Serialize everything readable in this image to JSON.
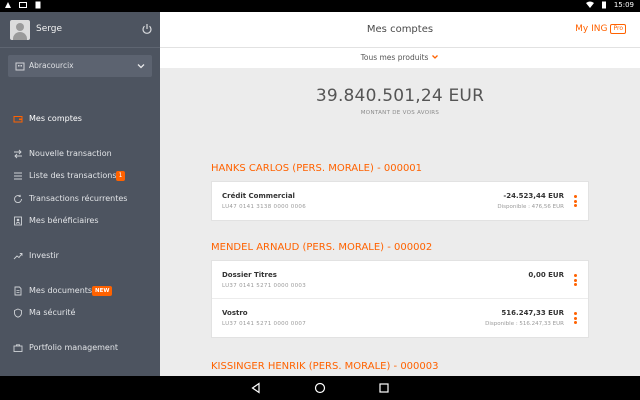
{
  "status_bar": {
    "time": "15:09"
  },
  "sidebar": {
    "user_name": "Serge",
    "company": "Abracourcix",
    "items": [
      {
        "label": "Mes comptes",
        "icon": "wallet-icon"
      },
      {
        "label": "Nouvelle transaction",
        "icon": "transfer-arrows-icon"
      },
      {
        "label": "Liste des transactions",
        "icon": "list-icon",
        "badge": "1"
      },
      {
        "label": "Transactions récurrentes",
        "icon": "recurring-icon"
      },
      {
        "label": "Mes bénéficiaires",
        "icon": "contacts-icon"
      },
      {
        "label": "Investir",
        "icon": "trend-up-icon"
      },
      {
        "label": "Mes documents",
        "icon": "document-icon",
        "badge": "NEW"
      },
      {
        "label": "Ma sécurité",
        "icon": "shield-icon"
      },
      {
        "label": "Portfolio management",
        "icon": "briefcase-icon"
      }
    ]
  },
  "header": {
    "title": "Mes comptes",
    "my_ing": "My ING",
    "pro": "Pro"
  },
  "filter": {
    "label": "Tous mes produits"
  },
  "summary": {
    "amount": "39.840.501,24 EUR",
    "caption": "MONTANT DE VOS AVOIRS"
  },
  "groups": [
    {
      "title": "HANKS CARLOS (PERS. MORALE) - 000001",
      "accounts": [
        {
          "name": "Crédit Commercial",
          "iban": "LU47 0141 3138 0000 0006",
          "balance": "-24.523,44  EUR",
          "available": "Disponible : 476,56  EUR"
        }
      ]
    },
    {
      "title": "MENDEL ARNAUD (PERS. MORALE) - 000002",
      "accounts": [
        {
          "name": "Dossier Titres",
          "iban": "LU37 0141 5271 0000 0003",
          "balance": "0,00  EUR",
          "available": ""
        },
        {
          "name": "Vostro",
          "iban": "LU37 0141 5271 0000 0007",
          "balance": "516.247,33  EUR",
          "available": "Disponible : 516.247,33  EUR"
        }
      ]
    },
    {
      "title": "KISSINGER HENRIK (PERS. MORALE) - 000003",
      "accounts": []
    }
  ]
}
